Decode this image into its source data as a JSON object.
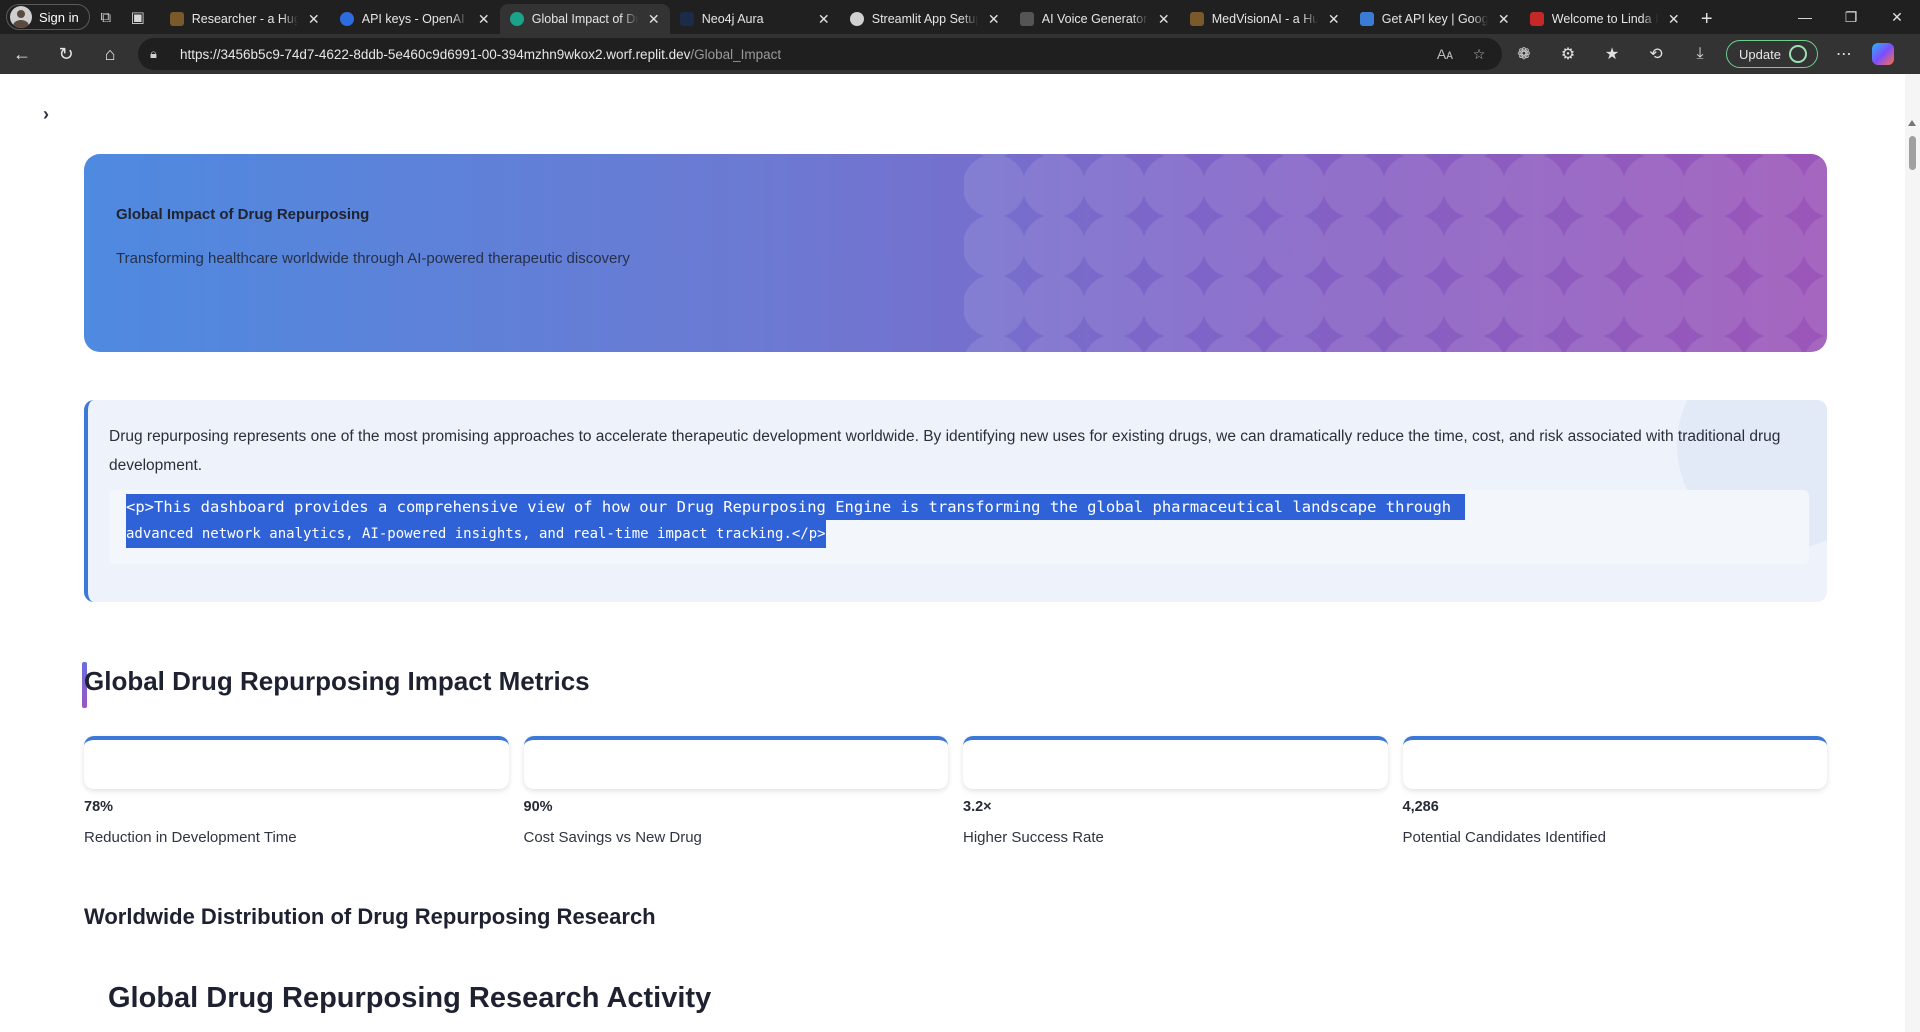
{
  "browser": {
    "signin_label": "Sign in",
    "tabs": [
      {
        "title": "Researcher - a Hugg",
        "color": "#7a5a2a",
        "active": false
      },
      {
        "title": "API keys - OpenAI A",
        "color": "#2d6cdf",
        "active": false
      },
      {
        "title": "Global Impact of Dru",
        "color": "#1aa38a",
        "active": true
      },
      {
        "title": "Neo4j Aura",
        "color": "#1b2b4a",
        "active": false
      },
      {
        "title": "Streamlit App Setup",
        "color": "#d0d0d0",
        "active": false
      },
      {
        "title": "AI Voice Generator &",
        "color": "#555555",
        "active": false
      },
      {
        "title": "MedVisionAI - a Hug",
        "color": "#7a5a2a",
        "active": false
      },
      {
        "title": "Get API key | Google",
        "color": "#3a7bd5",
        "active": false
      },
      {
        "title": "Welcome to Linda Ik",
        "color": "#c62828",
        "active": false
      }
    ],
    "url_host": "https://3456b5c9-74d7-4622-8ddb-5e460c9d6991-00-394mzhn9wkox2.worf.replit.dev",
    "url_path": "/Global_Impact",
    "update_label": "Update"
  },
  "hero": {
    "title": "Global Impact of Drug Repurposing",
    "subtitle": "Transforming healthcare worldwide through AI-powered therapeutic discovery"
  },
  "intro": {
    "paragraph": "Drug repurposing represents one of the most promising approaches to accelerate therapeutic development worldwide. By identifying new uses for existing drugs, we can dramatically reduce the time, cost, and risk associated with traditional drug development.",
    "code_line1": "<p>This dashboard provides a comprehensive view of how our Drug Repurposing Engine is transforming the global pharmaceutical landscape through",
    "code_line2": "advanced network analytics, AI-powered insights, and real-time impact tracking.</p>"
  },
  "metrics_heading": "Global Drug Repurposing Impact Metrics",
  "metrics": [
    {
      "value": "78%",
      "label": "Reduction in Development Time"
    },
    {
      "value": "90%",
      "label": "Cost Savings vs New Drug"
    },
    {
      "value": "3.2×",
      "label": "Higher Success Rate"
    },
    {
      "value": "4,286",
      "label": "Potential Candidates Identified"
    }
  ],
  "distribution_heading": "Worldwide Distribution of Drug Repurposing Research",
  "research_heading": "Global Drug Repurposing Research Activity"
}
